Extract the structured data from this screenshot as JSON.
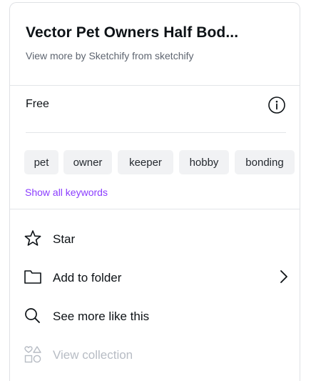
{
  "header": {
    "title": "Vector Pet Owners Half Bod...",
    "subtitle": "View more by Sketchify from sketchify"
  },
  "license": {
    "label": "Free",
    "info_icon": "info-circle-icon"
  },
  "keywords": {
    "chips": [
      "pet",
      "owner",
      "keeper",
      "hobby",
      "bonding"
    ],
    "show_all_label": "Show all keywords"
  },
  "menu": {
    "star": {
      "label": "Star",
      "icon": "star-icon"
    },
    "folder": {
      "label": "Add to folder",
      "icon": "folder-icon",
      "chevron": "chevron-right-icon"
    },
    "more": {
      "label": "See more like this",
      "icon": "search-icon"
    },
    "collection": {
      "label": "View collection",
      "icon": "shapes-icon",
      "disabled": true
    }
  },
  "colors": {
    "accent": "#8b3dff",
    "text": "#0d1216",
    "muted": "#5e6570",
    "disabled": "#b7bcc4",
    "chip_bg": "#f1f2f4"
  }
}
